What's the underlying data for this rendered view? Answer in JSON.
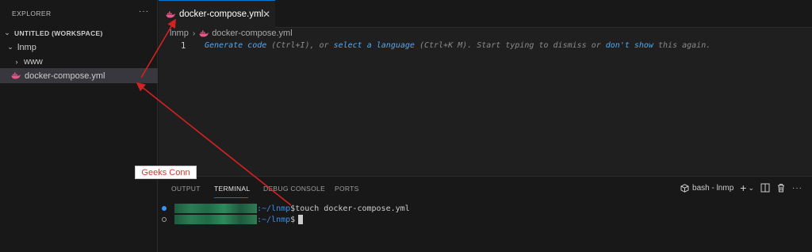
{
  "sidebar": {
    "title": "EXPLORER",
    "more_icon": "ellipsis-icon",
    "workspace_label": "UNTITLED (WORKSPACE)",
    "items": [
      {
        "label": "lnmp",
        "type": "folder",
        "expanded": true
      },
      {
        "label": "www",
        "type": "folder",
        "expanded": false
      },
      {
        "label": "docker-compose.yml",
        "type": "file",
        "icon": "docker-whale-icon"
      }
    ]
  },
  "editor": {
    "tab_label": "docker-compose.yml",
    "close_icon": "close-icon",
    "breadcrumb": [
      "lnmp",
      "docker-compose.yml"
    ],
    "line_number": "1",
    "hint": {
      "link1": "Generate code",
      "text1": " (Ctrl+I), or ",
      "link2": "select a language",
      "text2": " (Ctrl+K M). Start typing to dismiss or ",
      "link3": "don't show",
      "text3": " this again."
    }
  },
  "panel": {
    "tabs": [
      "OUTPUT",
      "TERMINAL",
      "DEBUG CONSOLE",
      "PORTS"
    ],
    "active_tab": "TERMINAL",
    "terminal_name": "bash - lnmp",
    "lines": [
      {
        "path": ":~/lnmp",
        "prompt": "$",
        "command": " touch docker-compose.yml"
      },
      {
        "path": ":~/lnmp",
        "prompt": "$",
        "command": ""
      }
    ]
  },
  "annotation": {
    "label": "Geeks Conn",
    "color": "#d42222"
  },
  "colors": {
    "accent": "#0078d4",
    "docker_icon": "#e8578a",
    "link": "#4daafc",
    "terminal_path": "#3b8eea"
  }
}
